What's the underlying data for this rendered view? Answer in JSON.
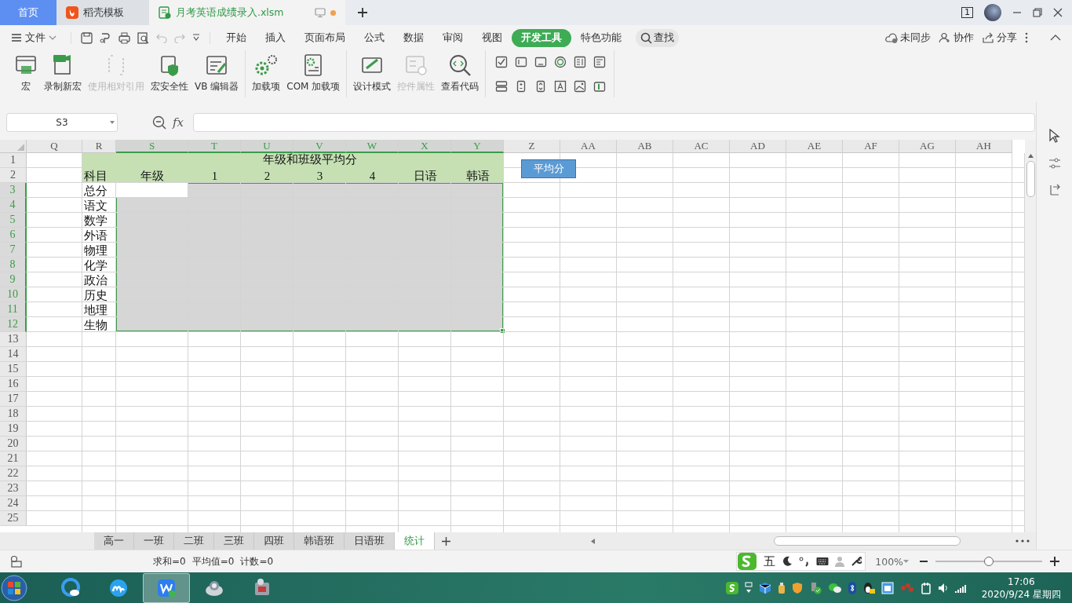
{
  "title_bar": {
    "tabs": [
      {
        "label": "首页",
        "selected": false,
        "kind": "home"
      },
      {
        "label": "稻壳模板",
        "selected": false,
        "kind": "docer"
      },
      {
        "label": "月考英语成绩录入.xlsm",
        "selected": true,
        "kind": "file",
        "unsaved": true
      }
    ],
    "window_count": "1"
  },
  "menu": {
    "file": "文件",
    "items": [
      {
        "label": "开始",
        "selected": false
      },
      {
        "label": "插入",
        "selected": false
      },
      {
        "label": "页面布局",
        "selected": false
      },
      {
        "label": "公式",
        "selected": false
      },
      {
        "label": "数据",
        "selected": false
      },
      {
        "label": "审阅",
        "selected": false
      },
      {
        "label": "视图",
        "selected": false
      },
      {
        "label": "开发工具",
        "selected": true
      },
      {
        "label": "特色功能",
        "selected": false
      }
    ],
    "search": "查找",
    "actions": [
      "未同步",
      "协作",
      "分享"
    ]
  },
  "ribbon": {
    "groups": [
      [
        {
          "label": "宏",
          "disabled": false,
          "kind": "macro"
        },
        {
          "label": "录制新宏",
          "disabled": false,
          "kind": "record"
        },
        {
          "label": "使用相对引用",
          "disabled": true,
          "kind": "relative"
        },
        {
          "label": "宏安全性",
          "disabled": false,
          "kind": "security"
        },
        {
          "label": "VB 编辑器",
          "disabled": false,
          "kind": "editor"
        }
      ],
      [
        {
          "label": "加载项",
          "disabled": false,
          "kind": "addin"
        },
        {
          "label": "COM 加载项",
          "disabled": false,
          "kind": "com"
        }
      ],
      [
        {
          "label": "设计模式",
          "disabled": false,
          "kind": "design"
        },
        {
          "label": "控件属性",
          "disabled": true,
          "kind": "props"
        },
        {
          "label": "查看代码",
          "disabled": false,
          "kind": "code"
        }
      ]
    ]
  },
  "formula_bar": {
    "name_box": "S3",
    "fx": "fx"
  },
  "sheet": {
    "columns": [
      {
        "label": "Q",
        "selected": false
      },
      {
        "label": "R",
        "selected": false
      },
      {
        "label": "S",
        "selected": true
      },
      {
        "label": "T",
        "selected": true
      },
      {
        "label": "U",
        "selected": true
      },
      {
        "label": "V",
        "selected": true
      },
      {
        "label": "W",
        "selected": true
      },
      {
        "label": "X",
        "selected": true
      },
      {
        "label": "Y",
        "selected": true
      },
      {
        "label": "Z",
        "selected": false
      },
      {
        "label": "AA",
        "selected": false
      },
      {
        "label": "AB",
        "selected": false
      },
      {
        "label": "AC",
        "selected": false
      },
      {
        "label": "AD",
        "selected": false
      },
      {
        "label": "AE",
        "selected": false
      },
      {
        "label": "AF",
        "selected": false
      },
      {
        "label": "AG",
        "selected": false
      },
      {
        "label": "AH",
        "selected": false
      }
    ],
    "rows": [
      {
        "label": "1",
        "selected": false,
        "kind": "header",
        "title": "年级和班级平均分"
      },
      {
        "label": "2",
        "selected": false,
        "kind": "header",
        "cells": [
          "科目",
          "年级",
          "1",
          "2",
          "3",
          "4",
          "日语",
          "韩语"
        ]
      },
      {
        "label": "3",
        "selected": true,
        "kind": "body",
        "cells": [
          "总分"
        ]
      },
      {
        "label": "4",
        "selected": true,
        "kind": "body",
        "cells": [
          "语文"
        ]
      },
      {
        "label": "5",
        "selected": true,
        "kind": "body",
        "cells": [
          "数学"
        ]
      },
      {
        "label": "6",
        "selected": true,
        "kind": "body",
        "cells": [
          "外语"
        ]
      },
      {
        "label": "7",
        "selected": true,
        "kind": "body",
        "cells": [
          "物理"
        ]
      },
      {
        "label": "8",
        "selected": true,
        "kind": "body",
        "cells": [
          "化学"
        ]
      },
      {
        "label": "9",
        "selected": true,
        "kind": "body",
        "cells": [
          "政治"
        ]
      },
      {
        "label": "10",
        "selected": true,
        "kind": "body",
        "cells": [
          "历史"
        ]
      },
      {
        "label": "11",
        "selected": true,
        "kind": "body",
        "cells": [
          "地理"
        ]
      },
      {
        "label": "12",
        "selected": true,
        "kind": "body",
        "cells": [
          "生物"
        ]
      },
      {
        "label": "13",
        "selected": false,
        "kind": "body"
      },
      {
        "label": "14",
        "selected": false,
        "kind": "body"
      },
      {
        "label": "15",
        "selected": false,
        "kind": "body"
      },
      {
        "label": "16",
        "selected": false,
        "kind": "body"
      },
      {
        "label": "17",
        "selected": false,
        "kind": "body"
      },
      {
        "label": "18",
        "selected": false,
        "kind": "body"
      },
      {
        "label": "19",
        "selected": false,
        "kind": "body"
      },
      {
        "label": "20",
        "selected": false,
        "kind": "body"
      },
      {
        "label": "21",
        "selected": false,
        "kind": "body"
      },
      {
        "label": "22",
        "selected": false,
        "kind": "body"
      },
      {
        "label": "23",
        "selected": false,
        "kind": "body"
      },
      {
        "label": "24",
        "selected": false,
        "kind": "body"
      },
      {
        "label": "25",
        "selected": false,
        "kind": "body"
      }
    ],
    "shape": {
      "label": "平均分"
    }
  },
  "sheet_tabs": [
    {
      "label": "高一",
      "selected": false
    },
    {
      "label": "一班",
      "selected": false
    },
    {
      "label": "二班",
      "selected": false
    },
    {
      "label": "三班",
      "selected": false
    },
    {
      "label": "四班",
      "selected": false
    },
    {
      "label": "韩语班",
      "selected": false
    },
    {
      "label": "日语班",
      "selected": false
    },
    {
      "label": "统计",
      "selected": true
    }
  ],
  "status_bar": {
    "stats": [
      "求和=0",
      "平均值=0",
      "计数=0"
    ],
    "ime": "五",
    "zoom": "100%",
    "zoom_slider": {
      "level": 0.5
    }
  },
  "taskbar": {
    "apps": [
      {
        "selected": false
      },
      {
        "selected": false
      },
      {
        "selected": true
      },
      {
        "selected": false
      },
      {
        "selected": false
      }
    ],
    "time": "17:06",
    "date": "2020/9/24 星期四"
  }
}
